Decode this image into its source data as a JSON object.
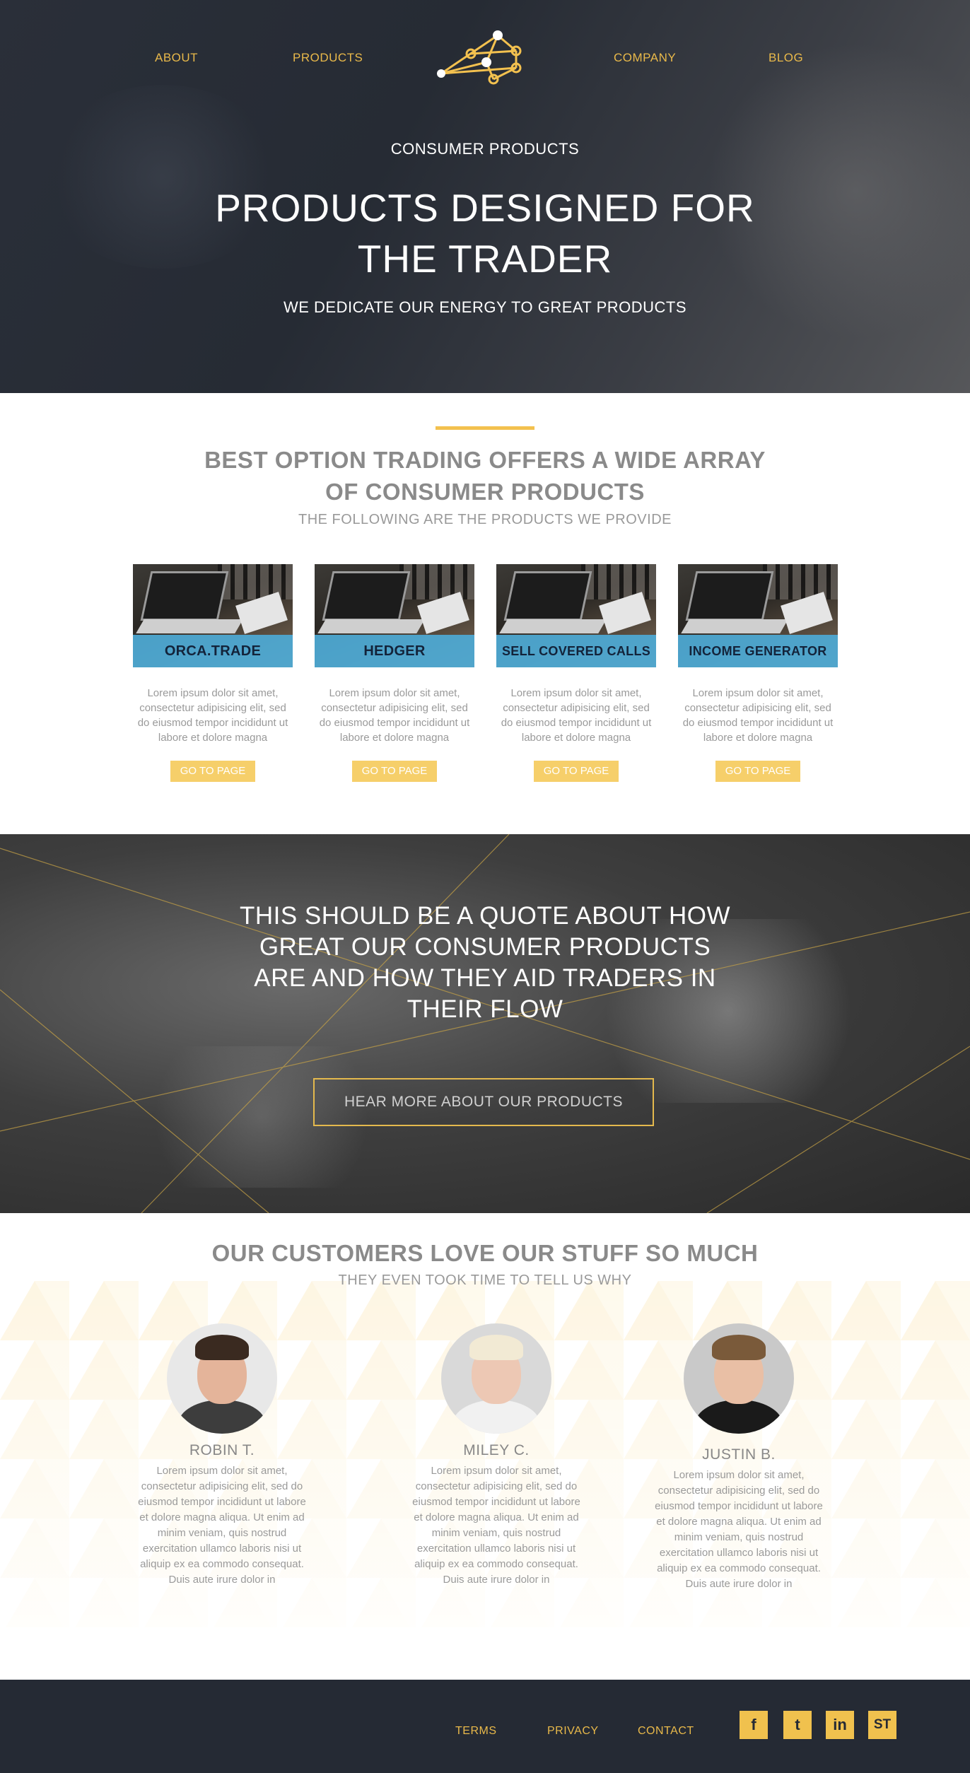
{
  "nav": {
    "about": "ABOUT",
    "products": "PRODUCTS",
    "company": "COMPANY",
    "blog": "BLOG"
  },
  "hero": {
    "kicker": "CONSUMER PRODUCTS",
    "title": "PRODUCTS DESIGNED FOR THE TRADER",
    "subtitle": "WE DEDICATE OUR ENERGY TO GREAT PRODUCTS"
  },
  "products_section": {
    "title": "BEST OPTION TRADING OFFERS A WIDE ARRAY OF CONSUMER PRODUCTS",
    "subtitle": "THE FOLLOWING ARE THE PRODUCTS WE PROVIDE",
    "cards": [
      {
        "name": "ORCA.TRADE",
        "body": "Lorem ipsum dolor sit amet, consectetur adipisicing elit, sed do eiusmod tempor incididunt ut labore et dolore magna",
        "button": "GO TO PAGE"
      },
      {
        "name": "HEDGER",
        "body": "Lorem ipsum dolor sit amet, consectetur adipisicing elit, sed do eiusmod tempor incididunt ut labore et dolore magna",
        "button": "GO TO PAGE"
      },
      {
        "name": "SELL COVERED CALLS",
        "body": "Lorem ipsum dolor sit amet, consectetur adipisicing elit, sed do eiusmod tempor incididunt ut labore et dolore magna",
        "button": "GO TO PAGE"
      },
      {
        "name": "INCOME GENERATOR",
        "body": "Lorem ipsum dolor sit amet, consectetur adipisicing elit, sed do eiusmod tempor incididunt ut labore et dolore magna",
        "button": "GO TO PAGE"
      }
    ]
  },
  "quote": {
    "text": "THIS SHOULD BE A QUOTE ABOUT HOW GREAT OUR CONSUMER PRODUCTS ARE AND HOW THEY AID TRADERS IN THEIR FLOW",
    "button": "HEAR MORE ABOUT OUR PRODUCTS"
  },
  "testimonials": {
    "title": "OUR CUSTOMERS LOVE OUR STUFF SO MUCH",
    "subtitle": "THEY EVEN TOOK TIME TO TELL US WHY",
    "people": [
      {
        "name": "ROBIN T.",
        "text": "Lorem ipsum dolor sit amet, consectetur adipisicing elit, sed do eiusmod tempor incididunt ut labore et dolore magna aliqua. Ut enim ad minim veniam, quis nostrud exercitation ullamco laboris nisi ut aliquip ex ea commodo consequat. Duis aute irure dolor in"
      },
      {
        "name": "MILEY C.",
        "text": "Lorem ipsum dolor sit amet, consectetur adipisicing elit, sed do eiusmod tempor incididunt ut labore et dolore magna aliqua. Ut enim ad minim veniam, quis nostrud exercitation ullamco laboris nisi ut aliquip ex ea commodo consequat. Duis aute irure dolor in"
      },
      {
        "name": "JUSTIN B.",
        "text": "Lorem ipsum dolor sit amet, consectetur adipisicing elit, sed do eiusmod tempor incididunt ut labore et dolore magna aliqua. Ut enim ad minim veniam, quis nostrud exercitation ullamco laboris nisi ut aliquip ex ea commodo consequat. Duis aute irure dolor in"
      }
    ]
  },
  "footer": {
    "terms": "TERMS",
    "privacy": "PRIVACY",
    "contact": "CONTACT",
    "social": [
      {
        "icon": "facebook-icon",
        "glyph": "f"
      },
      {
        "icon": "twitter-icon",
        "glyph": "t"
      },
      {
        "icon": "linkedin-icon",
        "glyph": "in"
      },
      {
        "icon": "st-icon",
        "glyph": "ST"
      }
    ]
  },
  "colors": {
    "accent_gold": "#f3c14f",
    "dark_navy": "#252a34",
    "product_band_blue": "#4daad6"
  }
}
